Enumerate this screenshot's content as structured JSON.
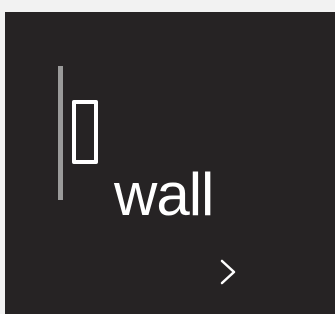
{
  "main": {
    "label": "wall",
    "next_icon": "chevron-right-icon",
    "indicator_icon": "wall-icon"
  },
  "colors": {
    "background": "#262324",
    "outer_background": "#f2f2f2",
    "text": "#ffffff",
    "bar": "#9a9a9a"
  }
}
